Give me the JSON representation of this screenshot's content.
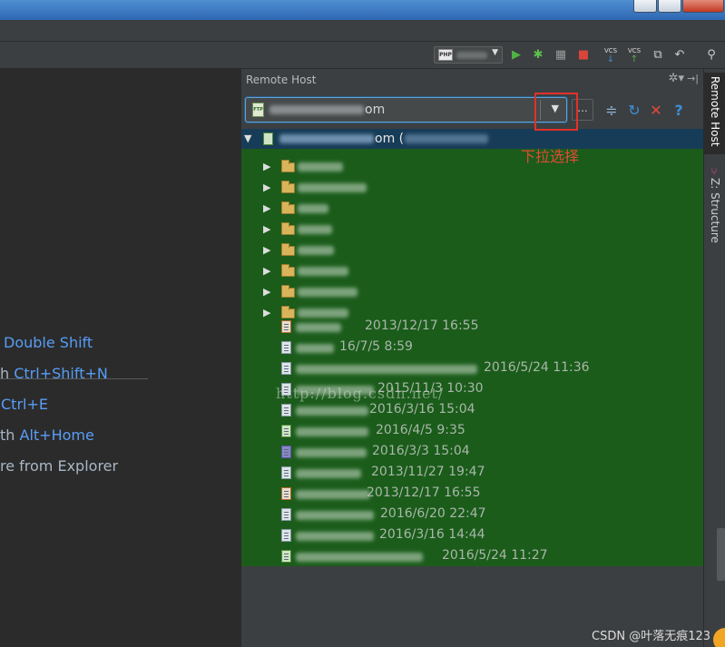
{
  "panel": {
    "title": "Remote Host",
    "server_suffix": "om",
    "root_suffix": "om ("
  },
  "toolbar": {
    "vcs_update_label": "VCS",
    "vcs_commit_label": "VCS"
  },
  "annotation": "下拉选择",
  "watermark": "http://blog.csdn.net/",
  "editor_hints": [
    {
      "prefix": "",
      "key": "Double Shift"
    },
    {
      "prefix": "h",
      "key": "Ctrl+Shift+N"
    },
    {
      "prefix": "",
      "key": "Ctrl+E"
    },
    {
      "prefix": "th",
      "key": "Alt+Home"
    },
    {
      "prefix": "re from Explorer",
      "key": ""
    }
  ],
  "files": [
    {
      "date": "2013/12/17 16:55",
      "icon": "orange"
    },
    {
      "date": "16/7/5 8:59",
      "icon": "plain"
    },
    {
      "date": "2016/5/24 11:36",
      "icon": "plain"
    },
    {
      "date": "2015/11/3 10:30",
      "icon": "plain"
    },
    {
      "date": "2016/3/16 15:04",
      "icon": "plain"
    },
    {
      "date": "2016/4/5 9:35",
      "icon": "green"
    },
    {
      "date": "2016/3/3 15:04",
      "icon": "purple"
    },
    {
      "date": "2013/11/27 19:47",
      "icon": "plain"
    },
    {
      "date": "2013/12/17 16:55",
      "icon": "orange"
    },
    {
      "date": "2016/6/20 22:47",
      "icon": "plain"
    },
    {
      "date": "2016/3/16 14:44",
      "icon": "plain"
    },
    {
      "date": "2016/5/24 11:27",
      "icon": "green"
    }
  ],
  "sidebar_tabs": {
    "remote_host": "Remote Host",
    "structure": "Z: Structure"
  },
  "footer": "CSDN @叶落无痕123",
  "colors": {
    "tree_background": "#1b5c1b",
    "selected_row": "#173c57",
    "highlight_box": "#e2312b",
    "annotation_text": "#e44a34",
    "key_text": "#589df6"
  }
}
